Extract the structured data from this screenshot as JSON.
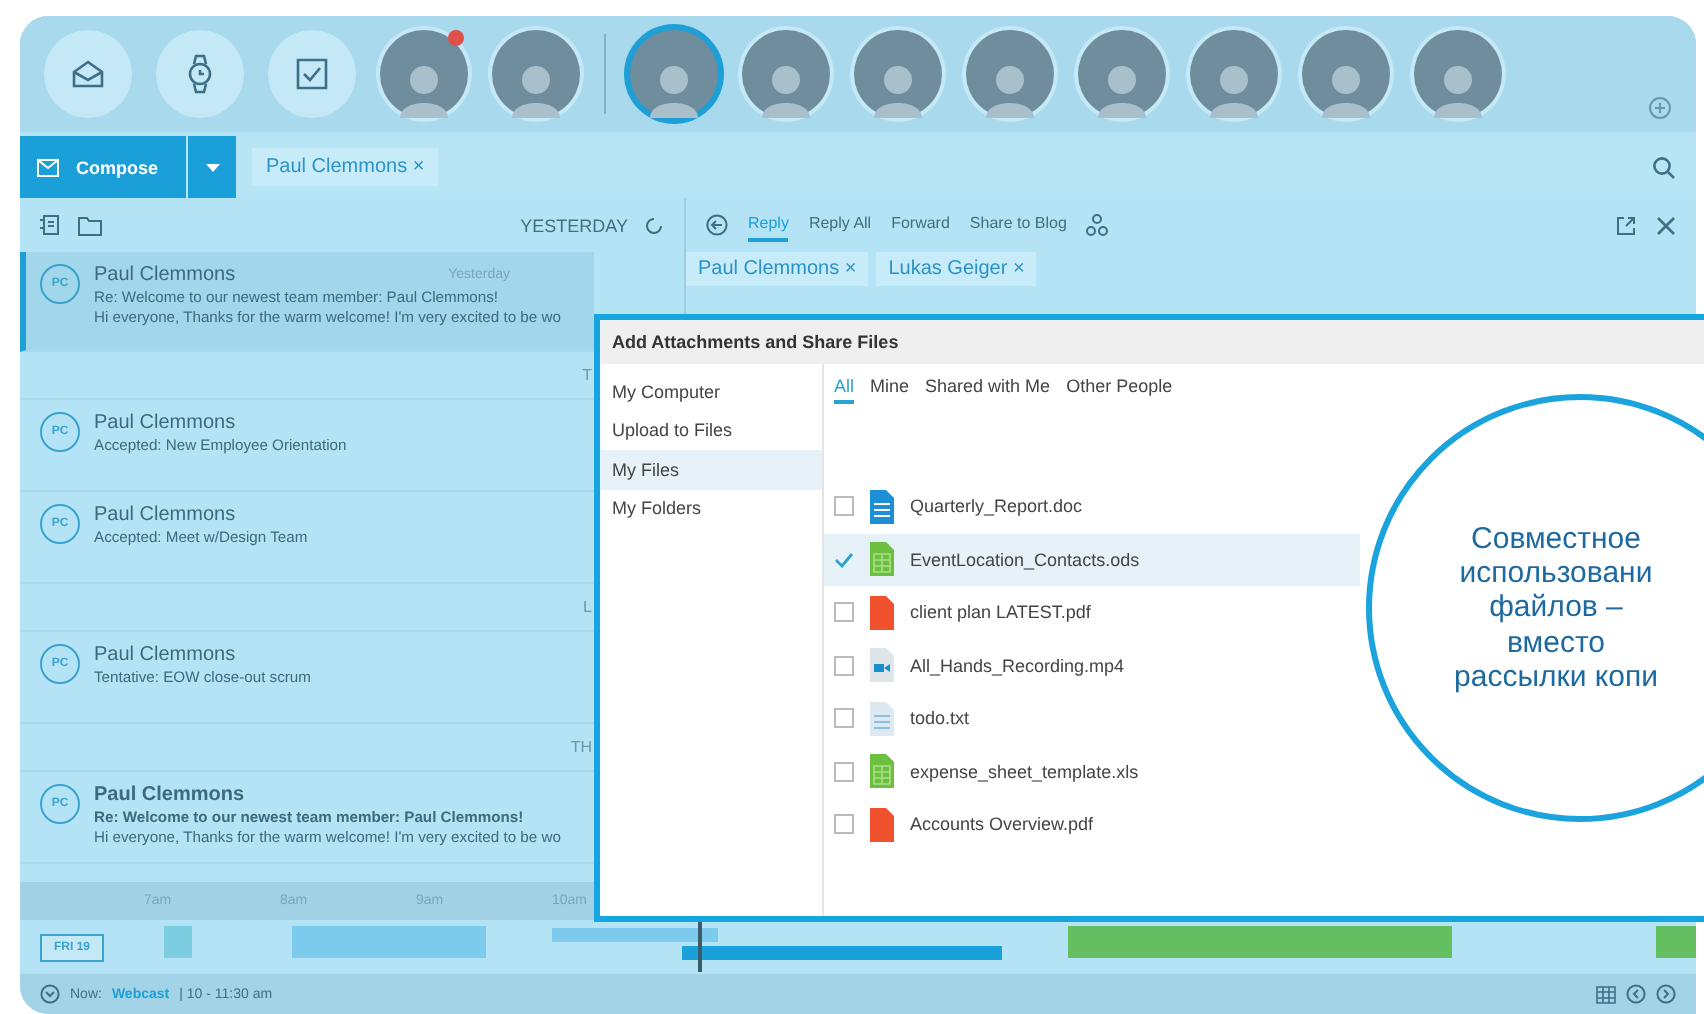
{
  "top_bar": {
    "apps": [
      {
        "kind": "mail"
      },
      {
        "kind": "watch"
      },
      {
        "kind": "tasks"
      }
    ],
    "people": [
      {
        "kind": "person",
        "selected": false,
        "notification": true
      },
      {
        "kind": "person",
        "selected": false,
        "notification": false
      },
      {
        "kind": "separator"
      },
      {
        "kind": "person",
        "selected": true,
        "notification": false
      },
      {
        "kind": "person",
        "selected": false,
        "notification": false
      },
      {
        "kind": "person",
        "selected": false,
        "notification": false
      },
      {
        "kind": "person",
        "selected": false,
        "notification": false
      },
      {
        "kind": "person",
        "selected": false,
        "notification": false
      },
      {
        "kind": "person",
        "selected": false,
        "notification": false
      },
      {
        "kind": "person",
        "selected": false,
        "notification": false
      },
      {
        "kind": "person",
        "selected": false,
        "notification": false
      }
    ]
  },
  "compose": {
    "label": "Compose",
    "filter_chip": "Paul Clemmons ×"
  },
  "message_list": {
    "header": "YESTERDAY",
    "items": [
      {
        "kind": "message",
        "initials": "PC",
        "sender": "Paul Clemmons",
        "subject": "Re: Welcome to our newest team member: Paul Clemmons!",
        "preview": "Hi everyone, Thanks for the warm welcome! I'm very excited to be wo",
        "time": "Yesterday",
        "selected": true,
        "unread": false
      },
      {
        "kind": "divider",
        "label": "T"
      },
      {
        "kind": "message",
        "initials": "PC",
        "sender": "Paul Clemmons",
        "subject": "Accepted: New Employee Orientation",
        "selected": false,
        "unread": false
      },
      {
        "kind": "message",
        "initials": "PC",
        "sender": "Paul Clemmons",
        "subject": "Accepted: Meet w/Design Team",
        "selected": false,
        "unread": false
      },
      {
        "kind": "divider",
        "label": "L"
      },
      {
        "kind": "message",
        "initials": "PC",
        "sender": "Paul Clemmons",
        "subject": "Tentative: EOW close-out scrum",
        "selected": false,
        "unread": false
      },
      {
        "kind": "divider",
        "label": "TH"
      },
      {
        "kind": "message",
        "initials": "PC",
        "sender": "Paul Clemmons",
        "subject": "Re: Welcome to our newest team member: Paul Clemmons!",
        "preview": "Hi everyone, Thanks for the warm welcome! I'm very excited to be wo",
        "selected": false,
        "unread": true
      }
    ]
  },
  "reader": {
    "actions": [
      {
        "label": "Reply",
        "selected": true
      },
      {
        "label": "Reply All",
        "selected": false
      },
      {
        "label": "Forward",
        "selected": false
      },
      {
        "label": "Share to Blog",
        "selected": false
      }
    ],
    "recipients": [
      "Paul Clemmons ×",
      "Lukas Geiger ×"
    ]
  },
  "timeline": {
    "hours": [
      "7am",
      "8am",
      "9am",
      "10am"
    ],
    "day": "FRI 19"
  },
  "status_bar": {
    "now_label": "Now:",
    "event": "Webcast",
    "time": "| 10 - 11:30 am"
  },
  "dialog": {
    "title": "Add Attachments and Share Files",
    "sources": [
      {
        "label": "My Computer",
        "selected": false
      },
      {
        "label": "Upload to Files",
        "selected": false
      },
      {
        "label": "My Files",
        "selected": true
      },
      {
        "label": "My Folders",
        "selected": false
      }
    ],
    "tabs": [
      {
        "label": "All",
        "selected": true
      },
      {
        "label": "Mine",
        "selected": false
      },
      {
        "label": "Shared with Me",
        "selected": false
      },
      {
        "label": "Other People",
        "selected": false
      }
    ],
    "files": [
      {
        "name": "Quarterly_Report.doc",
        "kind": "doc",
        "checked": false
      },
      {
        "name": "EventLocation_Contacts.ods",
        "kind": "sheet",
        "checked": true
      },
      {
        "name": "client plan LATEST.pdf",
        "kind": "pdf",
        "checked": false
      },
      {
        "name": "All_Hands_Recording.mp4",
        "kind": "video",
        "checked": false
      },
      {
        "name": "todo.txt",
        "kind": "text",
        "checked": false
      },
      {
        "name": "expense_sheet_template.xls",
        "kind": "sheet",
        "checked": false
      },
      {
        "name": "Accounts Overview.pdf",
        "kind": "pdf",
        "checked": false
      }
    ]
  },
  "callout": {
    "text": "Совместное\nиспользовани\nфайлов –\nвместо\nрассылки копи"
  }
}
